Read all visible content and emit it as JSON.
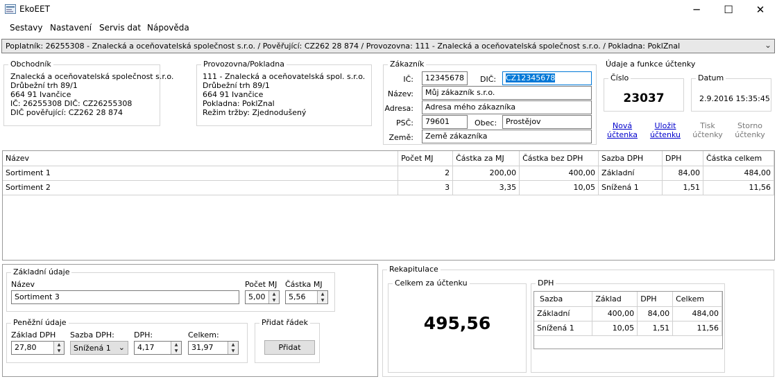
{
  "window": {
    "title": "EkoEET",
    "minimize": "─",
    "maximize": "☐",
    "close": "✕"
  },
  "menu": [
    "Sestavy",
    "Nastavení",
    "Servis dat",
    "Nápověda"
  ],
  "combo": {
    "value": "Poplatník: 26255308 - Znalecká a oceňovatelská společnost s.r.o. / Pověřující: CZ262 28 874 / Provozovna: 111 - Znalecká a oceňovatelská společnost s.r.o. / Pokladna: PoklZnal"
  },
  "obchodnik": {
    "title": "Obchodník",
    "lines": [
      "Znalecká a oceňovatelská společnost s.r.o.",
      "Drůbežní trh 89/1",
      "664 91 Ivančice",
      "IČ: 26255308 DIČ: CZ26255308",
      "DIČ pověřující: CZ262 28 874"
    ]
  },
  "provozovna": {
    "title": "Provozovna/Pokladna",
    "lines": [
      "111 - Znalecká a oceňovatelská spol. s.r.o.",
      "Drůbežní trh 89/1",
      "664 91 Ivančice",
      "Pokladna: PoklZnal",
      "Režim tržby: Zjednodušený"
    ]
  },
  "zakaznik": {
    "title": "Zákazník",
    "ic_label": "IČ:",
    "ic": "12345678",
    "dic_label": "DIČ:",
    "dic": "CZ12345678",
    "nazev_label": "Název:",
    "nazev": "Můj zákazník s.r.o.",
    "adresa_label": "Adresa:",
    "adresa": "Adresa mého zákazníka",
    "psc_label": "PSČ:",
    "psc": "79601",
    "obec_label": "Obec:",
    "obec": "Prostějov",
    "zeme_label": "Země:",
    "zeme": "Země zákazníka"
  },
  "uctenka": {
    "title": "Údaje a funkce účtenky",
    "cislo_label": "Číslo",
    "cislo": "23037",
    "datum_label": "Datum",
    "datum": "2.9.2016 15:35:45",
    "nova_1": "Nová",
    "nova_2": "účtenka",
    "ulozit_1": "Uložit",
    "ulozit_2": "účtenku",
    "tisk_1": "Tisk",
    "tisk_2": "účtenky",
    "storno_1": "Storno",
    "storno_2": "účtenky"
  },
  "items": {
    "headers": [
      "Název",
      "Počet MJ",
      "Částka za MJ",
      "Částka bez DPH",
      "Sazba DPH",
      "DPH",
      "Částka celkem"
    ],
    "rows": [
      [
        "Sortiment 1",
        "2",
        "200,00",
        "400,00",
        "Základní",
        "84,00",
        "484,00"
      ],
      [
        "Sortiment 2",
        "3",
        "3,35",
        "10,05",
        "Snížená 1",
        "1,51",
        "11,56"
      ]
    ]
  },
  "zakladni": {
    "title": "Základní údaje",
    "nazev_label": "Název",
    "nazev": "Sortiment 3",
    "pocet_label": "Počet MJ",
    "pocet": "5,00",
    "castka_label": "Částka MJ",
    "castka": "5,56"
  },
  "penezni": {
    "title": "Peněžní údaje",
    "zaklad_label": "Základ DPH",
    "zaklad": "27,80",
    "sazba_label": "Sazba DPH:",
    "sazba": "Snížená 1",
    "dph_label": "DPH:",
    "dph": "4,17",
    "celkem_label": "Celkem:",
    "celkem": "31,97"
  },
  "pridat": {
    "title": "Přidat řádek",
    "button": "Přidat"
  },
  "rekapitulace": {
    "title": "Rekapitulace",
    "celkem_label": "Celkem za účtenku",
    "celkem": "495,56",
    "dph_title": "DPH",
    "headers": [
      "Sazba",
      "Základ",
      "DPH",
      "Celkem"
    ],
    "rows": [
      [
        "Základní",
        "400,00",
        "84,00",
        "484,00"
      ],
      [
        "Snížená 1",
        "10,05",
        "1,51",
        "11,56"
      ]
    ]
  }
}
